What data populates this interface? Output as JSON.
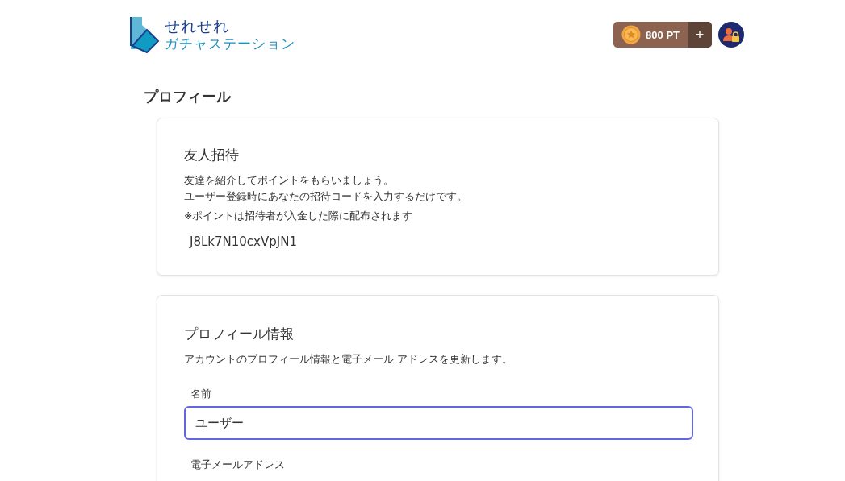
{
  "header": {
    "logo": {
      "line_1": "せれせれ",
      "line_2": "ガチャステーション"
    },
    "points": {
      "amount": "800 PT",
      "add": "+"
    }
  },
  "page_title": "プロフィール",
  "invite_card": {
    "title": "友人招待",
    "description": [
      "友達を紹介してポイントをもらいましょう。",
      "ユーザー登録時にあなたの招待コードを入力するだけです。"
    ],
    "note": "※ポイントは招待者が入金した際に配布されます",
    "code": "J8Lk7N10cxVpJN1"
  },
  "profile_card": {
    "title": "プロフィール情報",
    "description": "アカウントのプロフィール情報と電子メール アドレスを更新します。",
    "fields": [
      {
        "label": "名前",
        "value": "ユーザー",
        "focused": true
      },
      {
        "label": "電子メールアドレス"
      }
    ]
  }
}
